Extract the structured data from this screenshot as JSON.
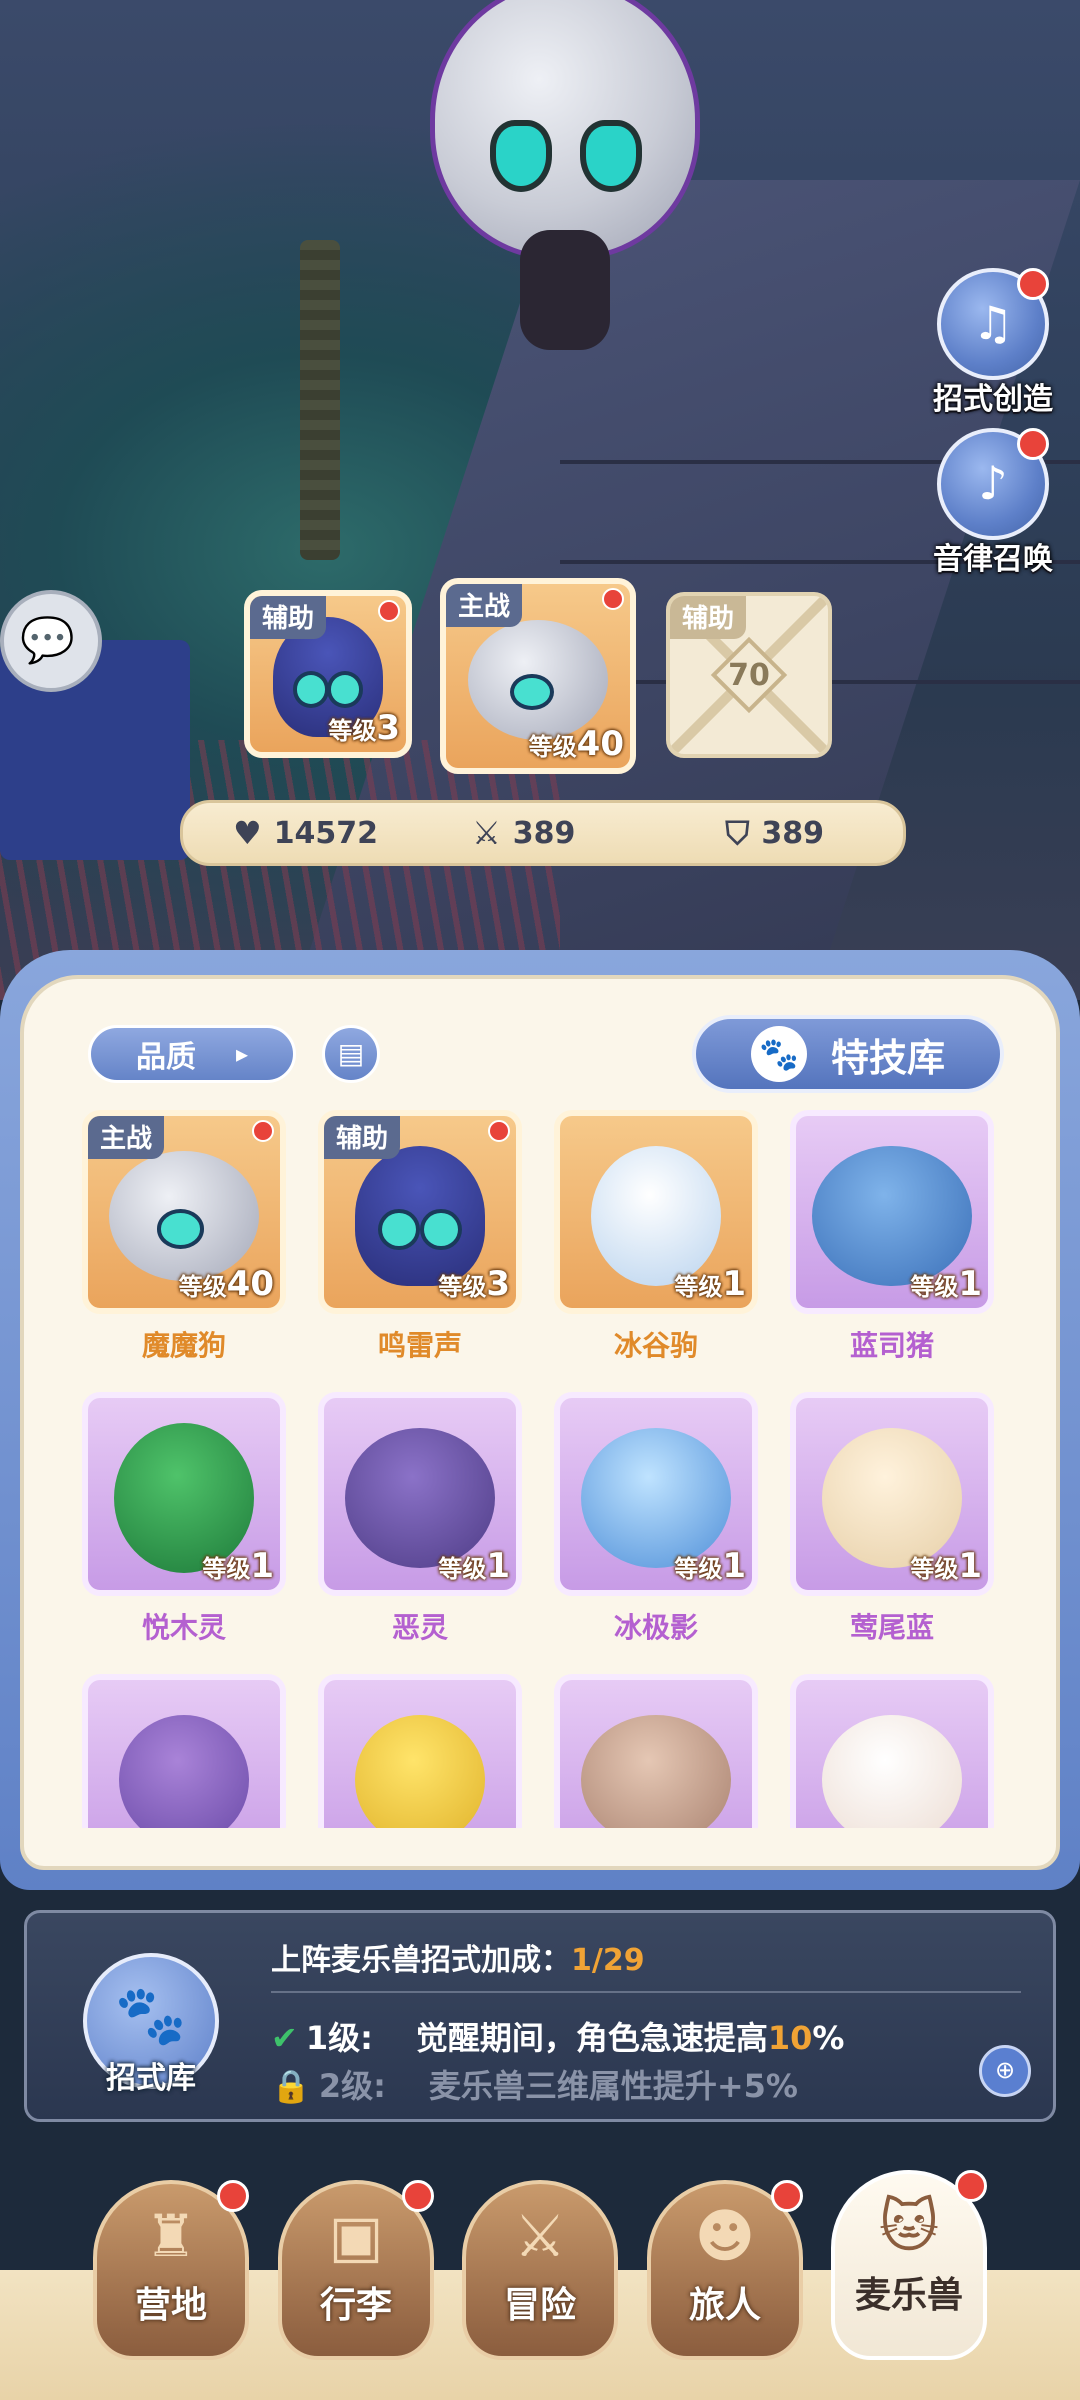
{
  "side_buttons": [
    {
      "label": "招式创造",
      "icon": "move-create-icon"
    },
    {
      "label": "音律召唤",
      "icon": "rhythm-summon-icon"
    }
  ],
  "team": [
    {
      "role": "辅助",
      "level_prefix": "等级",
      "level": "3"
    },
    {
      "role": "主战",
      "level_prefix": "等级",
      "level": "40"
    },
    {
      "role": "辅助",
      "locked_level": "70"
    }
  ],
  "stats": {
    "hp": "14572",
    "attack": "389",
    "defense": "389"
  },
  "filters": {
    "quality": "品质",
    "skill_library": "特技库"
  },
  "pets": [
    {
      "name": "魔魔狗",
      "level_prefix": "等级",
      "level": "40",
      "role": "主战",
      "rarity": "orange"
    },
    {
      "name": "鸣雷声",
      "level_prefix": "等级",
      "level": "3",
      "role": "辅助",
      "rarity": "orange"
    },
    {
      "name": "冰谷驹",
      "level_prefix": "等级",
      "level": "1",
      "role": "",
      "rarity": "orange"
    },
    {
      "name": "蓝司猪",
      "level_prefix": "等级",
      "level": "1",
      "role": "",
      "rarity": "purple"
    },
    {
      "name": "悦木灵",
      "level_prefix": "等级",
      "level": "1",
      "role": "",
      "rarity": "purple"
    },
    {
      "name": "恶灵",
      "level_prefix": "等级",
      "level": "1",
      "role": "",
      "rarity": "purple"
    },
    {
      "name": "冰极影",
      "level_prefix": "等级",
      "level": "1",
      "role": "",
      "rarity": "purple"
    },
    {
      "name": "莺尾蓝",
      "level_prefix": "等级",
      "level": "1",
      "role": "",
      "rarity": "purple"
    }
  ],
  "info_panel": {
    "icon_label": "招式库",
    "title": "上阵麦乐兽招式加成：",
    "progress": "1/29",
    "bonuses": [
      {
        "level": "1级:",
        "text_before": "觉醒期间，角色急速提高",
        "highlight": "10",
        "text_after": "%",
        "unlocked": true
      },
      {
        "level": "2级:",
        "text_before": "麦乐兽三维属性提升+5%",
        "highlight": "",
        "text_after": "",
        "unlocked": false
      }
    ]
  },
  "nav": [
    {
      "label": "营地",
      "icon": "castle-icon",
      "badge": true
    },
    {
      "label": "行李",
      "icon": "backpack-icon",
      "badge": true
    },
    {
      "label": "冒险",
      "icon": "crossed-swords-icon",
      "badge": false
    },
    {
      "label": "旅人",
      "icon": "traveler-icon",
      "badge": true
    },
    {
      "label": "麦乐兽",
      "icon": "cat-icon",
      "badge": true,
      "active": true
    }
  ],
  "colors": {
    "accent_blue": "#6584c8",
    "orange_name": "#e08a2a",
    "purple_name": "#b460d0",
    "highlight": "#f0a335"
  }
}
